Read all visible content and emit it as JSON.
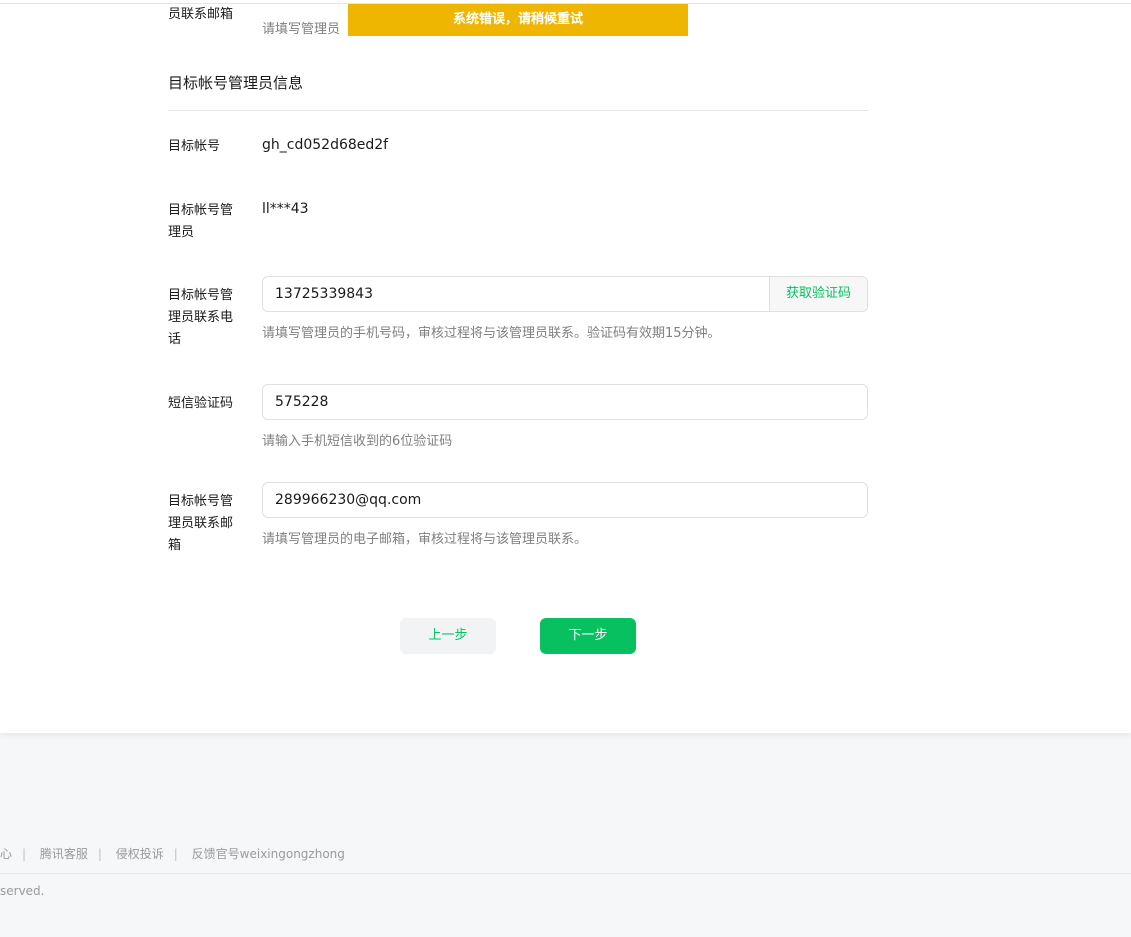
{
  "top_fragment": {
    "label": "员联系邮箱",
    "hint": "请填写管理员"
  },
  "toast": {
    "message": "系统错误，请稍候重试"
  },
  "section": {
    "title": "目标帐号管理员信息"
  },
  "fields": {
    "account": {
      "label": "目标帐号",
      "value": "gh_cd052d68ed2f"
    },
    "admin": {
      "label": "目标帐号管理员",
      "value": "ll***43"
    },
    "phone": {
      "label": "目标帐号管理员联系电话",
      "value": "13725339843",
      "button": "获取验证码",
      "hint": "请填写管理员的手机号码，审核过程将与该管理员联系。验证码有效期15分钟。"
    },
    "sms": {
      "label": "短信验证码",
      "value": "575228",
      "hint": "请输入手机短信收到的6位验证码"
    },
    "email": {
      "label": "目标帐号管理员联系邮箱",
      "value": "289966230@qq.com",
      "hint": "请填写管理员的电子邮箱，审核过程将与该管理员联系。"
    }
  },
  "actions": {
    "prev": "上一步",
    "next": "下一步"
  },
  "footer": {
    "links": [
      "心",
      "腾讯客服",
      "侵权投诉",
      "反馈官号weixingongzhong"
    ],
    "copyright": "served."
  }
}
